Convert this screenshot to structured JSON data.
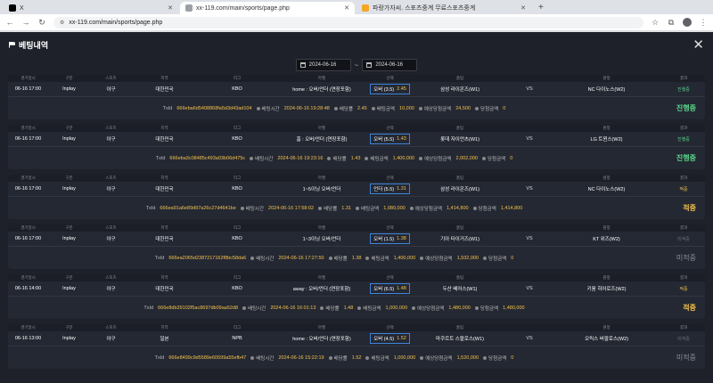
{
  "browser": {
    "tabs": [
      {
        "title": "X",
        "icon": "x-logo-icon",
        "color": "#000000"
      },
      {
        "title": "xx-119.com/main/sports/page.php",
        "icon": "page-icon",
        "color": "#9aa0a6"
      },
      {
        "title": "파랑가자씨. 스포츠중계 무료스포츠중계",
        "icon": "site-icon",
        "color": "#f5a623"
      }
    ],
    "new_tab": "+",
    "url": "xx-119.com/main/sports/page.php"
  },
  "modal": {
    "title": "베팅내역",
    "date_from": "2024-06-16",
    "date_to": "2024-06-16",
    "date_sep": "~"
  },
  "headers": [
    "경기일시",
    "구분",
    "스포츠",
    "지역",
    "리그",
    "마켓",
    "선택",
    "홈팀",
    "",
    "원정",
    "결과"
  ],
  "labels": {
    "txid": "TxId",
    "bet_time": "배팅시간",
    "odds": "배당률",
    "amount": "배팅금액",
    "expected": "예상당첨금액",
    "won": "당첨금액",
    "vs": "VS"
  },
  "colors": {
    "bg": "#1e2129",
    "card": "#242833",
    "accent": "#f5c24b",
    "progress": "#5ad68a",
    "pick_border": "#3d84d9"
  },
  "bets": [
    {
      "datetime": "06-16 17:00",
      "type": "Inplay",
      "sport": "야구",
      "region": "대한민국",
      "league": "KBO",
      "market": "home : 오버/언더 (연장포함)",
      "pick": "오버 (3.5)",
      "odds": "2.45",
      "home": "삼성 라이온즈(W1)",
      "away": "NC 다이노스(W2)",
      "result_small": "진행중",
      "txid": "666eba6d5408868fa5d3d43ad104",
      "bet_time": "2024-06-16 19:28:48",
      "amount": "10,000",
      "expected": "24,500",
      "won": "0",
      "result_big": "진행중",
      "status": "progress"
    },
    {
      "datetime": "06-16 17:00",
      "type": "Inplay",
      "sport": "야구",
      "region": "대한민국",
      "league": "KBO",
      "market": "홈 : 오버/언더 (연장포함)",
      "pick": "오버 (5.5)",
      "odds": "1.43",
      "home": "롯데 자이언츠(W1)",
      "away": "LG 트윈스(W2)",
      "result_small": "진행중",
      "txid": "666eba3c08485c493a03b06d475c",
      "bet_time": "2024-06-16 19:23:16",
      "amount": "1,400,000",
      "expected": "2,002,000",
      "won": "0",
      "result_big": "진행중",
      "status": "progress"
    },
    {
      "datetime": "06-16 17:00",
      "type": "Inplay",
      "sport": "야구",
      "region": "대한민국",
      "league": "KBO",
      "market": "1~5이닝 오버/언더",
      "pick": "언더 (5.5)",
      "odds": "1.31",
      "home": "삼성 라이온즈(W1)",
      "away": "NC 다이노스(W2)",
      "result_small": "적중",
      "txid": "666ea91a6e89d97a26c27d4641be",
      "bet_time": "2024-06-16 17:58:02",
      "amount": "1,080,000",
      "expected": "1,414,800",
      "won": "1,414,800",
      "result_big": "적중",
      "status": "hit"
    },
    {
      "datetime": "06-16 17:00",
      "type": "Inplay",
      "sport": "야구",
      "region": "대한민국",
      "league": "KBO",
      "market": "1~3이닝 오버/언더",
      "pick": "오버 (1.5)",
      "odds": "1.38",
      "home": "기아 타이거즈(W1)",
      "away": "KT 위즈(W2)",
      "result_small": "미적중",
      "txid": "666ea2065d2387217162f8bc58da6",
      "bet_time": "2024-06-16 17:27:50",
      "amount": "1,400,000",
      "expected": "1,932,000",
      "won": "0",
      "result_big": "미적중",
      "status": "pending"
    },
    {
      "datetime": "06-16 14:00",
      "type": "Inplay",
      "sport": "야구",
      "region": "대한민국",
      "league": "KBO",
      "market": "away : 오버/언더 (연장포함)",
      "pick": "오버 (6.5)",
      "odds": "1.48",
      "home": "두산 베어스(W1)",
      "away": "키움 히어로즈(W2)",
      "result_small": "적중",
      "txid": "666e8db39102f5ac8697db09aa52d8",
      "bet_time": "2024-06-16 16:01:13",
      "amount": "1,000,000",
      "expected": "1,480,000",
      "won": "1,480,000",
      "result_big": "적중",
      "status": "hit"
    },
    {
      "datetime": "06-16 13:00",
      "type": "Inplay",
      "sport": "야구",
      "region": "일본",
      "league": "NPB",
      "market": "home : 오버/언더 (연장포함)",
      "pick": "오버 (4.5)",
      "odds": "1.52",
      "home": "마쿠르트 스왈로스(W1)",
      "away": "오릭스 버팔로스(W2)",
      "result_small": "미적중",
      "txid": "666e8499c9d5589e60599a55efb47",
      "bet_time": "2024-06-16 15:22:19",
      "amount": "1,000,000",
      "expected": "1,520,000",
      "won": "0",
      "result_big": "미적중",
      "status": "pending"
    }
  ]
}
